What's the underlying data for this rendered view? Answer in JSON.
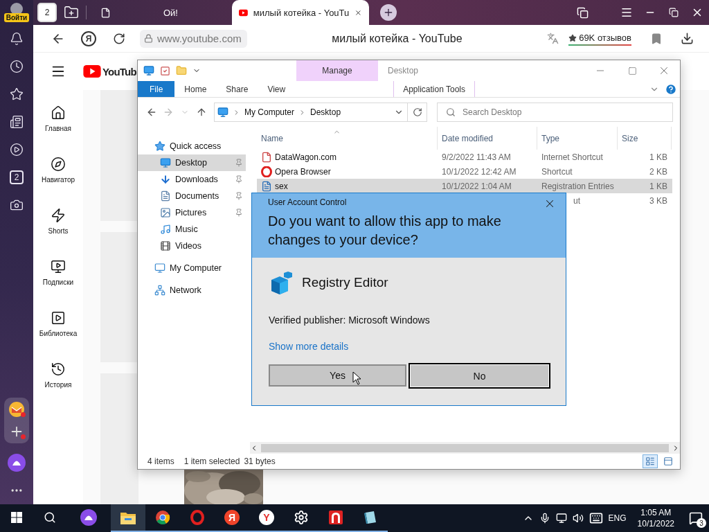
{
  "rail": {
    "login": "Войти",
    "items": [
      {
        "kind": "bell"
      },
      {
        "kind": "clock"
      },
      {
        "kind": "star"
      },
      {
        "kind": "pages"
      },
      {
        "kind": "play"
      },
      {
        "kind": "counter",
        "text": "2"
      },
      {
        "kind": "camera"
      }
    ],
    "bottom": [
      {
        "kind": "mail",
        "badge": true
      },
      {
        "kind": "add",
        "badge": true
      }
    ]
  },
  "tab_bar": {
    "counter": "2",
    "tabs": [
      {
        "title": "Ой!",
        "kind": "page",
        "selected": false
      },
      {
        "title": "милый котейка - YouTu",
        "kind": "video",
        "selected": true
      }
    ]
  },
  "address_bar": {
    "yandex": "Я",
    "url": "www.youtube.com",
    "title": "милый котейка - YouTube",
    "reviews": "69K отзывов"
  },
  "youtube": {
    "logo": "YouTub",
    "nav": [
      {
        "kind": "home",
        "label": "Главная"
      },
      {
        "kind": "navigator",
        "label": "Навигатор"
      },
      {
        "kind": "shorts",
        "label": "Shorts"
      },
      {
        "kind": "subscriptions",
        "label": "Подписки"
      },
      {
        "kind": "library",
        "label": "Библиотека"
      },
      {
        "kind": "history",
        "label": "История"
      }
    ]
  },
  "explorer": {
    "manage_tab": "Manage",
    "title": "Desktop",
    "ribbon_tabs": [
      {
        "label": "File",
        "kind": "backstage"
      },
      {
        "label": "Home",
        "kind": "tab"
      },
      {
        "label": "Share",
        "kind": "tab"
      },
      {
        "label": "View",
        "kind": "tab"
      }
    ],
    "context_tab": "Application Tools",
    "path": [
      "My Computer",
      "Desktop"
    ],
    "search": {
      "placeholder": "Search Desktop"
    },
    "nav": [
      {
        "label": "Quick access",
        "kind": "quick",
        "selected": false,
        "children": [
          {
            "label": "Desktop",
            "kind": "desktop",
            "pinned": true,
            "selected": true
          },
          {
            "label": "Downloads",
            "kind": "downloads",
            "pinned": true,
            "selected": false
          },
          {
            "label": "Documents",
            "kind": "documents",
            "pinned": true,
            "selected": false
          },
          {
            "label": "Pictures",
            "kind": "pictures",
            "pinned": true,
            "selected": false
          },
          {
            "label": "Music",
            "kind": "music",
            "pinned": false,
            "selected": false
          },
          {
            "label": "Videos",
            "kind": "videos",
            "pinned": false,
            "selected": false
          }
        ]
      },
      {
        "label": "My Computer",
        "kind": "computer",
        "selected": false
      },
      {
        "label": "Network",
        "kind": "network",
        "selected": false
      }
    ],
    "columns": [
      "Name",
      "Date modified",
      "Type",
      "Size"
    ],
    "files": [
      {
        "kind": "url",
        "name": "DataWagon.com",
        "date": "9/2/2022 11:43 AM",
        "type": "Internet Shortcut",
        "size": "1 KB",
        "selected": false
      },
      {
        "kind": "opera",
        "name": "Opera Browser",
        "date": "10/1/2022 12:42 AM",
        "type": "Shortcut",
        "size": "2 KB",
        "selected": false
      },
      {
        "kind": "reg",
        "name": "sex",
        "date": "10/1/2022 1:04 AM",
        "type": "Registration Entries",
        "size": "1 KB",
        "selected": true
      },
      {
        "type": "ut",
        "size": "3 KB",
        "selected": false
      }
    ],
    "status": {
      "count": "4 items",
      "selection": "1 item selected",
      "size": "31 bytes"
    }
  },
  "uac": {
    "title": "User Account Control",
    "question": "Do you want to allow this app to make changes to your device?",
    "app": "Registry Editor",
    "publisher": "Verified publisher: Microsoft Windows",
    "details_link": "Show more details",
    "buttons": [
      {
        "label": "Yes",
        "focused": false
      },
      {
        "label": "No",
        "focused": true
      }
    ]
  },
  "taskbar": {
    "apps": [
      {
        "kind": "alice",
        "running": false,
        "selected": false
      },
      {
        "kind": "explorer",
        "running": true,
        "selected": true
      },
      {
        "kind": "chrome",
        "running": true,
        "selected": false
      },
      {
        "kind": "opera",
        "running": true,
        "selected": false
      },
      {
        "kind": "yandex",
        "label": "Я",
        "running": true,
        "selected": false
      },
      {
        "kind": "yabrowser",
        "label": "Y",
        "running": true,
        "selected": false
      },
      {
        "kind": "settings",
        "running": true,
        "selected": false
      },
      {
        "kind": "arc",
        "running": true,
        "selected": false
      },
      {
        "kind": "notebook",
        "running": true,
        "selected": false
      }
    ],
    "language": "ENG",
    "time": "1:05 AM",
    "date": "10/1/2022",
    "notifications": "3"
  }
}
